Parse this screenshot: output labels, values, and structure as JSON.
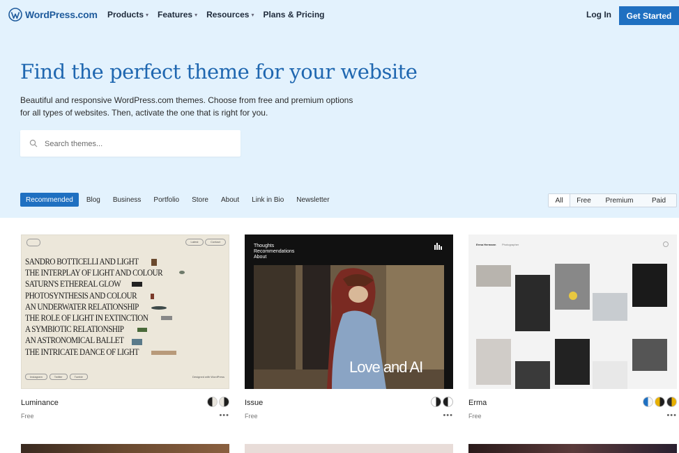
{
  "brand": {
    "logo_text": "WordPress.com",
    "primary_color": "#1f70c1",
    "hero_bg": "#e3f2fd"
  },
  "nav": {
    "items": [
      {
        "label": "Products",
        "has_menu": true
      },
      {
        "label": "Features",
        "has_menu": true
      },
      {
        "label": "Resources",
        "has_menu": true
      },
      {
        "label": "Plans & Pricing",
        "has_menu": false
      }
    ],
    "caret": "▾",
    "login_label": "Log In",
    "get_started_label": "Get Started"
  },
  "hero": {
    "title": "Find the perfect theme for your website",
    "description": "Beautiful and responsive WordPress.com themes. Choose from free and premium options for all types of websites. Then, activate the one that is right for you.",
    "search_placeholder": "Search themes..."
  },
  "categories": [
    "Recommended",
    "Blog",
    "Business",
    "Portfolio",
    "Store",
    "About",
    "Link in Bio",
    "Newsletter"
  ],
  "active_category": "Recommended",
  "price_filter": {
    "options": [
      "All",
      "Free",
      "Premium",
      "Paid"
    ],
    "active": "All"
  },
  "themes": [
    {
      "name": "Luminance",
      "price": "Free",
      "more": "•••",
      "style_variations": [
        "#1e1e1e",
        "#e8e4dc"
      ],
      "preview": {
        "bg": "#ece7da",
        "buttons": [
          "Latest",
          "Contact"
        ],
        "headlines": [
          "SANDRO BOTTICELLI AND LIGHT",
          "THE INTERPLAY OF LIGHT AND COLOUR",
          "SATURN'S ETHEREAL GLOW",
          "PHOTOSYNTHESIS AND COLOUR",
          "AN UNDERWATER RELATIONSHIP",
          "THE ROLE OF LIGHT IN EXTINCTION",
          "A SYMBIOTIC RELATIONSHIP",
          "AN ASTRONOMICAL BALLET",
          "THE INTRICATE DANCE OF LIGHT"
        ],
        "footer_tags": [
          "Instagram",
          "Twitter",
          "Tumblr"
        ],
        "footer_credit": "Designed with WordPress"
      }
    },
    {
      "name": "Issue",
      "price": "Free",
      "more": "•••",
      "style_variations": [
        "#1e1e1e",
        "#ffffff"
      ],
      "preview": {
        "menu": [
          "Thoughts",
          "Recommendations",
          "About"
        ],
        "headline": "Love and AI"
      }
    },
    {
      "name": "Erma",
      "price": "Free",
      "more": "•••",
      "style_variations": [
        "#1f70c1",
        "#e8b000",
        "#2b2b2b"
      ],
      "preview": {
        "site_title": "Erma Hermann",
        "site_nav": "Photographer"
      }
    }
  ]
}
